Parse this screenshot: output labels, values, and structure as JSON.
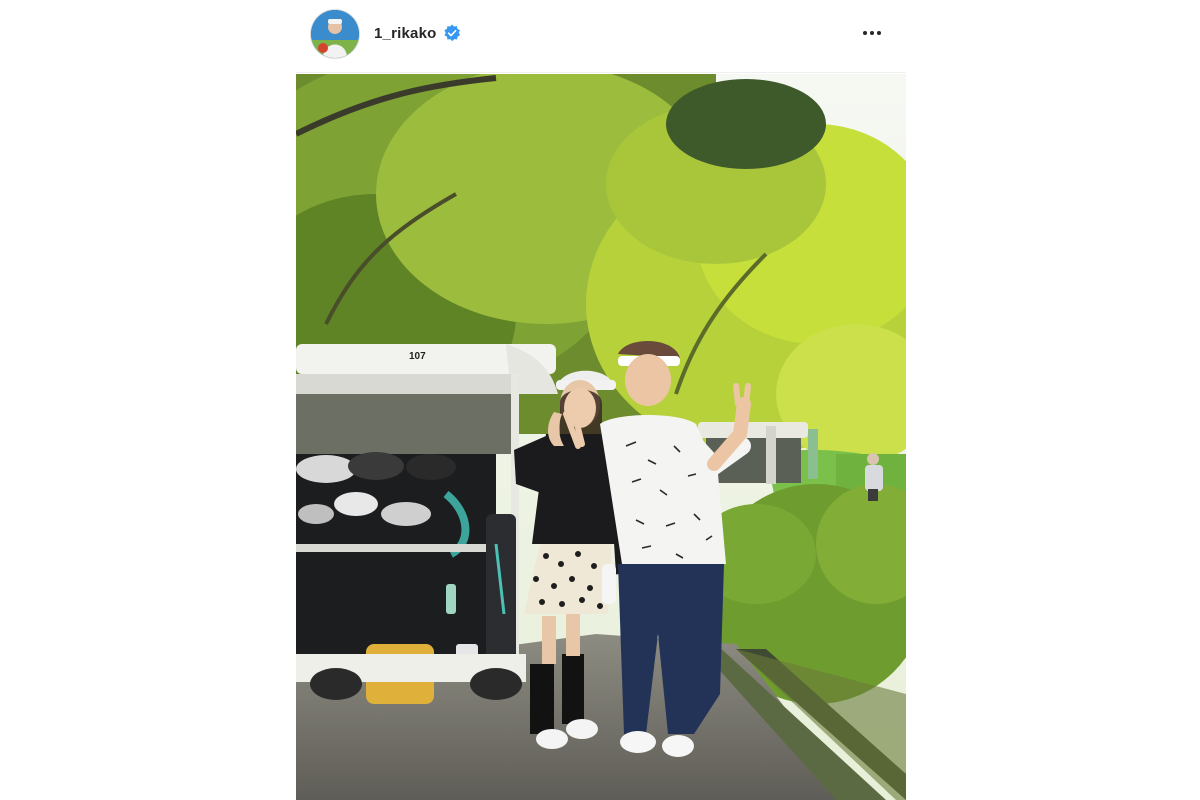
{
  "post": {
    "username": "1_rikako",
    "verified": true,
    "avatar_icon": "profile-avatar",
    "more_icon": "more-options-icon",
    "media_type": "photo",
    "cart_number": "107"
  },
  "colors": {
    "verified_badge": "#3897f0",
    "text": "#262626",
    "foliage_light": "#c7df3a",
    "foliage_dark": "#4e7a24"
  }
}
